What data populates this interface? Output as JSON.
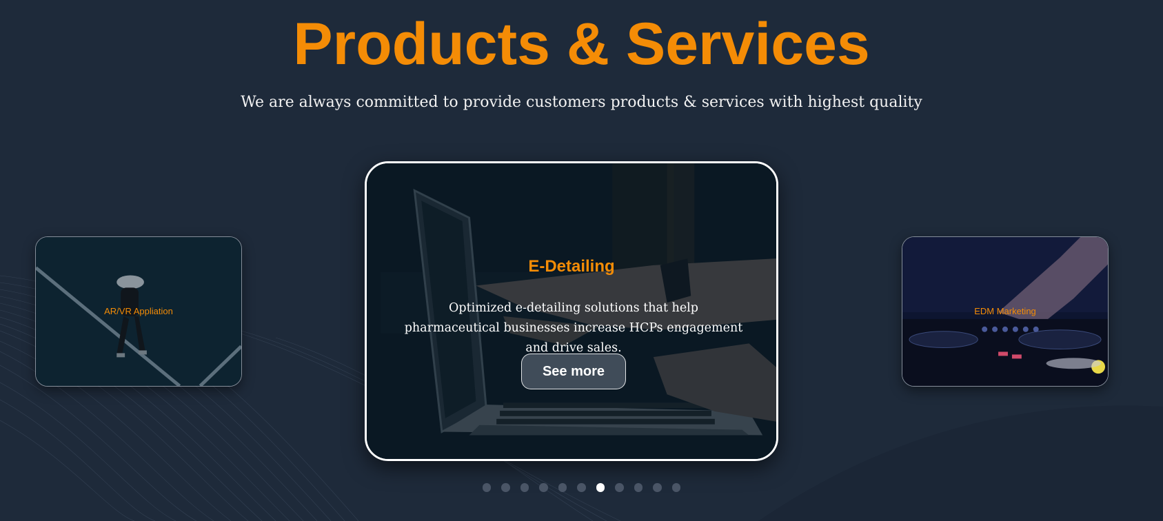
{
  "header": {
    "title": "Products & Services",
    "subtitle": "We are always committed to provide customers products & services with highest quality"
  },
  "carousel": {
    "left_card": {
      "label": "AR/VR Appliation"
    },
    "main_card": {
      "title": "E-Detailing",
      "description": "Optimized e-detailing solutions that help pharmaceutical businesses increase HCPs engagement and drive sales.",
      "button_label": "See more"
    },
    "right_card": {
      "label": "EDM Marketing"
    },
    "pagination": {
      "total": 11,
      "active_index": 6
    }
  },
  "colors": {
    "background": "#1e2a3a",
    "accent": "#f48c06",
    "text": "#ffffff"
  }
}
